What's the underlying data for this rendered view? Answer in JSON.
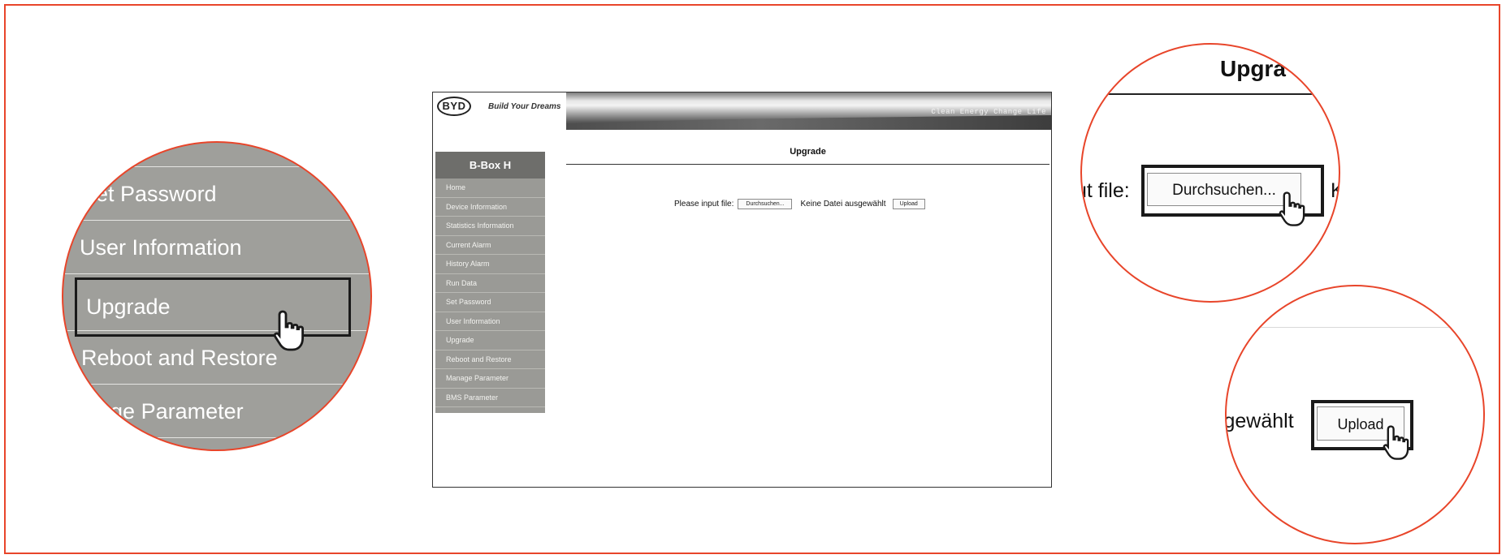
{
  "header": {
    "logo_text": "BYD",
    "slogan": "Build Your Dreams",
    "banner_tagline": "Clean Energy Change Life"
  },
  "sidebar": {
    "title": "B-Box H",
    "items": [
      {
        "label": "Home"
      },
      {
        "label": "Device Information"
      },
      {
        "label": "Statistics Information"
      },
      {
        "label": "Current Alarm"
      },
      {
        "label": "History Alarm"
      },
      {
        "label": "Run Data"
      },
      {
        "label": "Set Password"
      },
      {
        "label": "User Information"
      },
      {
        "label": "Upgrade"
      },
      {
        "label": "Reboot and Restore"
      },
      {
        "label": "Manage Parameter"
      },
      {
        "label": "BMS Parameter"
      }
    ]
  },
  "main": {
    "title": "Upgrade",
    "input_label": "Please input file:",
    "browse_button": "Durchsuchen...",
    "no_file_text": "Keine Datei ausgewählt",
    "upload_button": "Upload"
  },
  "zoom_menu": {
    "items": [
      {
        "label": "Set Password"
      },
      {
        "label": "User Information"
      },
      {
        "label": "Upgrade"
      },
      {
        "label": "Reboot and Restore"
      },
      {
        "label": "nage Parameter"
      }
    ]
  },
  "zoom_browse": {
    "title_fragment": "Upgra",
    "label_fragment": "ut file:",
    "button": "Durchsuchen...",
    "tail_fragment": "K"
  },
  "zoom_upload": {
    "label_fragment": "sgewählt",
    "button": "Upload"
  },
  "colors": {
    "accent": "#e8452a",
    "sidebar_bg": "#9a9a96",
    "sidebar_title_bg": "#6e6e6b",
    "highlight_box": "#1a1a1a"
  },
  "icons": [
    "hand-pointer-icon"
  ]
}
